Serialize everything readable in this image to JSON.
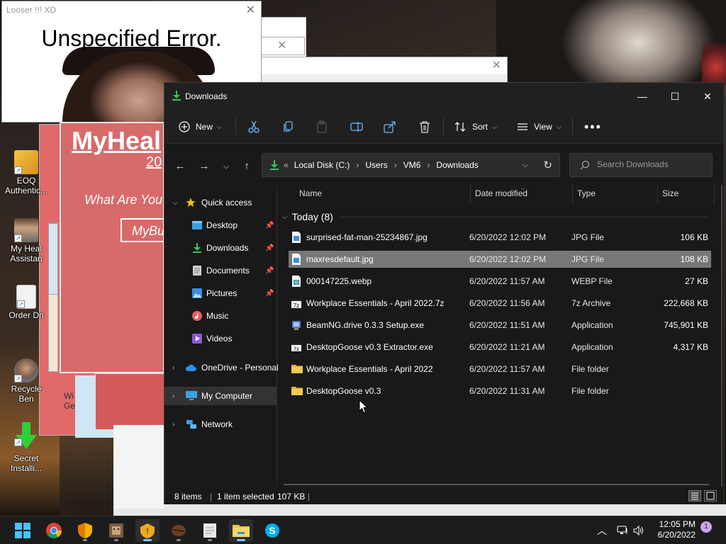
{
  "desktop": {
    "icons": [
      {
        "label": "EOQ Authentic...",
        "name": "desktop-icon-eoq"
      },
      {
        "label": "My Heal Assistan",
        "name": "desktop-icon-my-health-assistant"
      },
      {
        "label": "Order Dri",
        "name": "desktop-icon-order-drive"
      },
      {
        "label": "Recycle Ben",
        "name": "desktop-icon-recycle-ben"
      },
      {
        "label": "Secret Installi...",
        "name": "desktop-icon-secret-installer"
      }
    ],
    "partial_label_1": "Wi",
    "partial_label_2": "Ge"
  },
  "popups": {
    "error": {
      "title": "Looser !!! XD",
      "message": "Unspecified Error."
    },
    "myhealth": {
      "title": "MyHeal",
      "year": "20",
      "question": "What Are You",
      "button": "MyBu"
    }
  },
  "explorer": {
    "title": "Downloads",
    "toolbar": {
      "new": "New",
      "sort": "Sort",
      "view": "View"
    },
    "address": {
      "prefix": "«",
      "crumbs": [
        "Local Disk (C:)",
        "Users",
        "VM6",
        "Downloads"
      ]
    },
    "search": {
      "placeholder": "Search Downloads"
    },
    "nav": {
      "quick_access": "Quick access",
      "items": [
        "Desktop",
        "Downloads",
        "Documents",
        "Pictures",
        "Music",
        "Videos"
      ],
      "onedrive": "OneDrive - Personal",
      "my_computer": "My Computer",
      "network": "Network"
    },
    "columns": {
      "name": "Name",
      "date": "Date modified",
      "type": "Type",
      "size": "Size"
    },
    "group": "Today (8)",
    "files": [
      {
        "name": "surprised-fat-man-25234867.jpg",
        "date": "6/20/2022 12:02 PM",
        "type": "JPG File",
        "size": "106 KB"
      },
      {
        "name": "maxresdefault.jpg",
        "date": "6/20/2022 12:02 PM",
        "type": "JPG File",
        "size": "108 KB"
      },
      {
        "name": "000147225.webp",
        "date": "6/20/2022 11:57 AM",
        "type": "WEBP File",
        "size": "27 KB"
      },
      {
        "name": "Workplace Essentials - April 2022.7z",
        "date": "6/20/2022 11:56 AM",
        "type": "7z Archive",
        "size": "222,668 KB"
      },
      {
        "name": "BeamNG.drive 0.3.3 Setup.exe",
        "date": "6/20/2022 11:51 AM",
        "type": "Application",
        "size": "745,901 KB"
      },
      {
        "name": "DesktopGoose v0.3 Extractor.exe",
        "date": "6/20/2022 11:21 AM",
        "type": "Application",
        "size": "4,317 KB"
      },
      {
        "name": "Workplace Essentials - April 2022",
        "date": "6/20/2022 11:57 AM",
        "type": "File folder",
        "size": ""
      },
      {
        "name": "DesktopGoose v0.3",
        "date": "6/20/2022 11:31 AM",
        "type": "File folder",
        "size": ""
      }
    ],
    "status": {
      "items": "8 items",
      "selected": "1 item selected",
      "selected_size": "107 KB",
      "sep": "|"
    }
  },
  "taskbar": {
    "time": "12:05 PM",
    "date": "6/20/2022",
    "notifications": "1"
  },
  "colors": {
    "accent": "#7cc4ff",
    "selected_row": "#777777",
    "window_bg": "#191919",
    "folder": "#f2c14e",
    "download_green": "#3fbf5a"
  }
}
